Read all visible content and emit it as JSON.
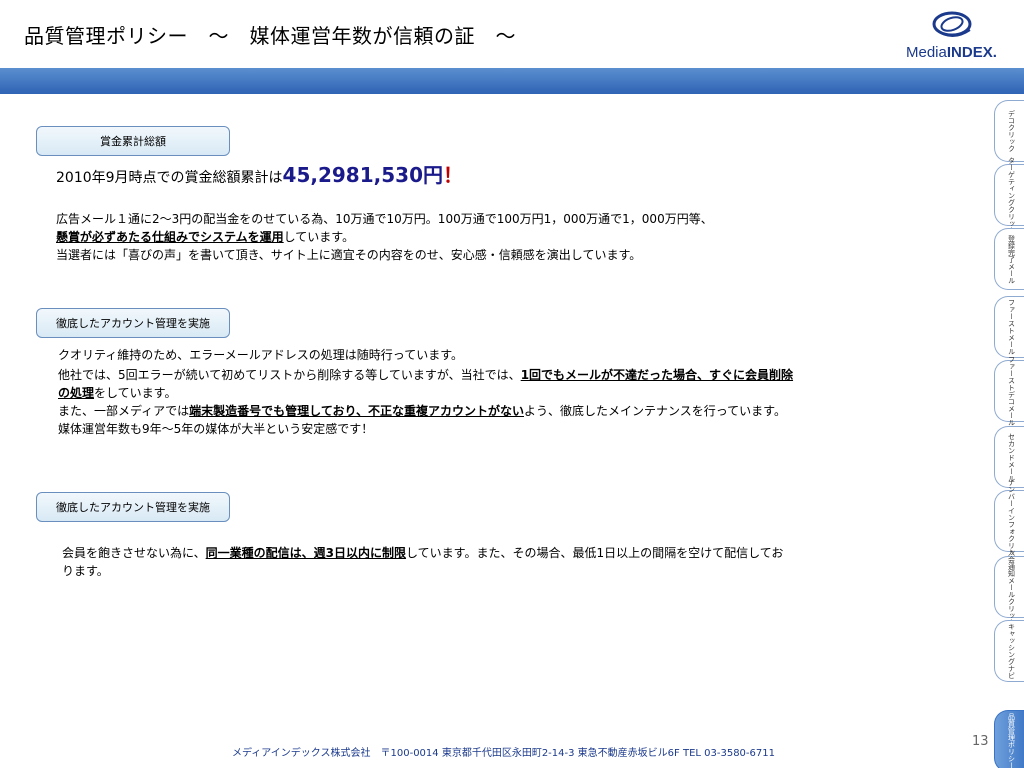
{
  "title": "品質管理ポリシー　～　媒体運営年数が信頼の証　～",
  "logo": {
    "text_light": "Media",
    "text_bold": "INDEX."
  },
  "section1": {
    "label": "賞金累計総額",
    "line1_prefix": "2010年9月時点での賞金総額累計は",
    "line1_amount": "45,2981,530円",
    "line1_suffix": "！",
    "para1": "広告メール１通に2～3円の配当金をのせている為、10万通で10万円。100万通で100万円1，000万通で1，000万円等、",
    "para2_bold": "懸賞が必ずあたる仕組みでシステムを運用",
    "para2_rest": "しています。",
    "para3": "当選者には「喜びの声」を書いて頂き、サイト上に適宜その内容をのせ、安心感・信頼感を演出しています。"
  },
  "section2": {
    "label": "徹底したアカウント管理を実施",
    "line1": "クオリティ維持のため、エラーメールアドレスの処理は随時行っています。",
    "line2_prefix": "他社では、5回エラーが続いて初めてリストから削除する等していますが、当社では、",
    "line2_bold": "1回でもメールが不達だった場合、すぐに会員削除",
    "line3_bold": "の処理",
    "line3_rest": "をしています。",
    "line4_prefix": "また、一部メディアでは",
    "line4_bold": "端末製造番号でも管理しており、不正な重複アカウントがない",
    "line4_suffix": "よう、徹底したメインテナンスを行っています。",
    "line5": "媒体運営年数も9年～5年の媒体が大半という安定感です！"
  },
  "section3": {
    "label": "徹底したアカウント管理を実施",
    "line1_prefix": "会員を飽きさせない為に、",
    "line1_bold": "同一業種の配信は、週3日以内に制限",
    "line1_suffix": "しています。また、その場合、最低1日以上の間隔を空けて配信してお",
    "line2": "ります。"
  },
  "side_tabs": [
    {
      "label": "デコクリック",
      "active": false
    },
    {
      "label": "ターゲティングクリック",
      "active": false
    },
    {
      "label": "登録完了メール",
      "active": false
    },
    {
      "label": "ファーストメール",
      "active": false
    },
    {
      "label": "ファーストデコメール",
      "active": false
    },
    {
      "label": "セカンドメール",
      "active": false
    },
    {
      "label": "ナンバーインフォクリック",
      "active": false
    },
    {
      "label": "入会通知メールクリック",
      "active": false
    },
    {
      "label": "キャッシングナビ",
      "active": false
    },
    {
      "label": "品質管理ポリシー",
      "active": true
    }
  ],
  "footer": "メディアインデックス株式会社　〒100-0014 東京都千代田区永田町2-14-3 東急不動産赤坂ビル6F TEL 03-3580-6711",
  "page_number": "13",
  "colors": {
    "accent_blue": "#2f63b4",
    "amount_color": "#1a1a8a",
    "exclaim_color": "#c00000"
  }
}
